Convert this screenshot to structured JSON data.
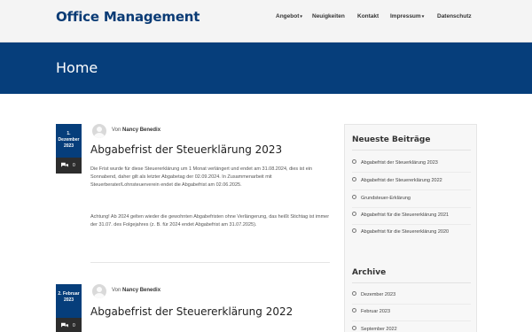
{
  "site": {
    "brand": "Office Management"
  },
  "nav": [
    {
      "label": "Angebot",
      "caret": "▾"
    },
    {
      "label": "Neuigkeiten"
    },
    {
      "label": "Kontakt"
    },
    {
      "label": "Impressum",
      "caret": "▾"
    },
    {
      "label": "Datenschutz"
    }
  ],
  "banner": {
    "title": "Home"
  },
  "posts": [
    {
      "date_line1": "1.",
      "date_line2": "Dezember",
      "date_line3": "2023",
      "comments": "0",
      "by": "Von",
      "author": "Nancy Benedix",
      "title": "Abgabefrist der Steuerklärung 2023",
      "para1": "Die Frist wurde für diese Steuererklärung um 1 Monat verlängert und endet am 31.08.2024, dies ist ein Sonnabend, daher gilt als letzter Abgabetag der 02.09.2024. In Zusammenarbeit mit Steuerberater/Lohnsteuerverein endet die Abgabefrist am 02.06.2025.",
      "para2": "Achtung! Ab 2024 gelten wieder die gewohnten Abgabefristen ohne Verlängerung, das heißt Stichtag ist immer der 31.07. des Folgejahres (z. B. für 2024 endet Abgabefrist am 31.07.2025)."
    },
    {
      "date_line1": "2. Februar",
      "date_line2": "2023",
      "comments": "0",
      "by": "Von",
      "author": "Nancy Benedix",
      "title": "Abgabefrist der Steuererklärung 2022"
    }
  ],
  "sidebar": {
    "recent_title": "Neueste Beiträge",
    "recent": [
      "Abgabefrist der Steuerklärung 2023",
      "Abgabefrist der Steuererklärung 2022",
      "Grundsteuer-Erklärung",
      "Abgabefrist für die Steuererklärung 2021",
      "Abgabefrist für die Steuererklärung 2020"
    ],
    "archive_title": "Archive",
    "archive": [
      "Dezember 2023",
      "Februar 2023",
      "September 2022"
    ]
  },
  "colors": {
    "brand": "#0a3b75",
    "banner": "#063e7b"
  }
}
